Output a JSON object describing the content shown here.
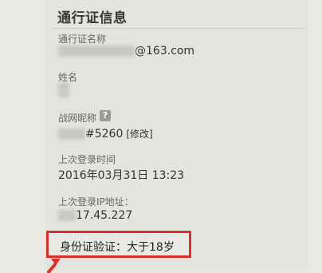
{
  "section": {
    "title": "通行证信息"
  },
  "fields": {
    "account_name_label": "通行证名称",
    "account_name_value_suffix": "@163.com",
    "real_name_label": "姓名",
    "nickname_label": "战网昵称",
    "nickname_help_icon": "?",
    "nickname_value_suffix": "#5260",
    "nickname_edit_label": "[修改]",
    "last_login_time_label": "上次登录时间",
    "last_login_time_value": "2016年03月31日 13:23",
    "last_login_ip_label": "上次登录IP地址：",
    "last_login_ip_value_suffix": "17.45.227",
    "id_verification_text": "身份证验证：大于18岁"
  },
  "colors": {
    "highlight_border": "#d9302b",
    "background": "#e9e8e3"
  },
  "icons": {
    "help": "question-mark-icon",
    "arrow": "red-arrow-icon"
  }
}
